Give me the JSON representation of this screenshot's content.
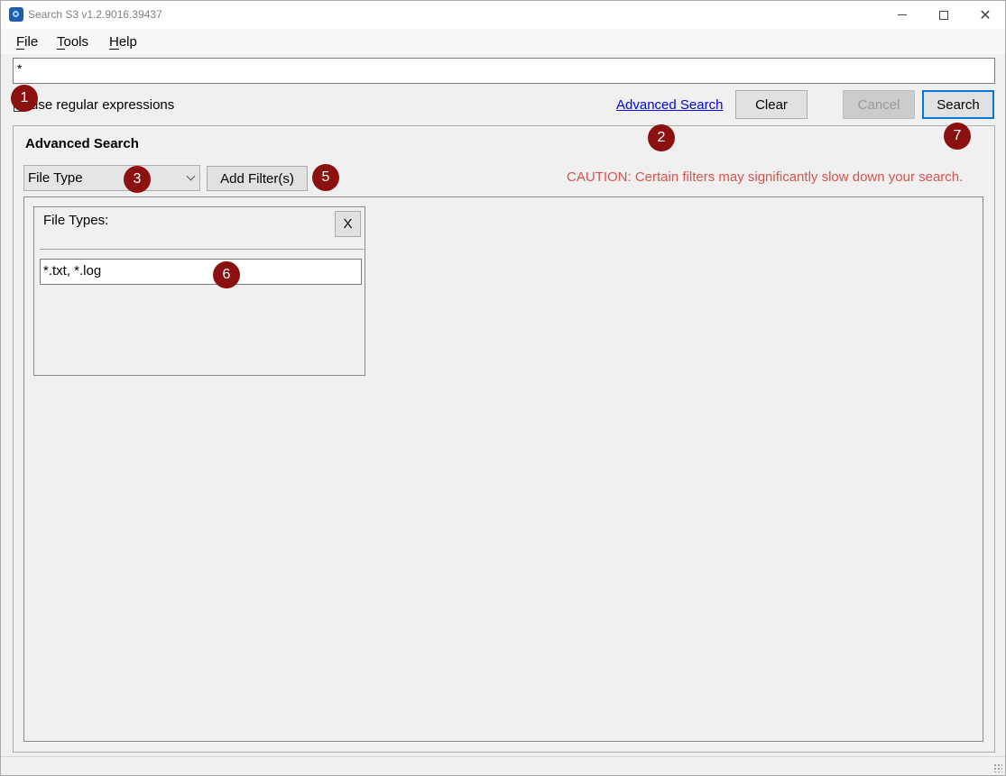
{
  "window": {
    "title": "Search S3 v1.2.9016.39437"
  },
  "menu": {
    "file": "File",
    "tools": "Tools",
    "help": "Help"
  },
  "search": {
    "query": "*"
  },
  "options": {
    "regex_label": "use regular expressions",
    "regex_checked": false
  },
  "toolbar": {
    "advanced_link": "Advanced Search",
    "clear_label": "Clear",
    "cancel_label": "Cancel",
    "search_label": "Search"
  },
  "advanced": {
    "title": "Advanced Search",
    "filter_type_selected": "File Type",
    "add_filter_label": "Add Filter(s)",
    "caution": "CAUTION: Certain filters may significantly slow down your search.",
    "filter_card": {
      "title": "File Types:",
      "remove_label": "X",
      "value": "*.txt, *.log"
    }
  },
  "badges": [
    "1",
    "2",
    "3",
    "5",
    "6",
    "7"
  ],
  "colors": {
    "accent": "#0078d7",
    "badge": "#8b1010",
    "caution": "#d9534f",
    "link": "#0000ee"
  },
  "icons": {
    "app": "search-s3-app-icon",
    "minimize": "minimize-icon",
    "maximize": "maximize-icon",
    "close": "close-icon",
    "dropdown": "chevron-down-icon",
    "grip": "resize-grip-icon"
  }
}
